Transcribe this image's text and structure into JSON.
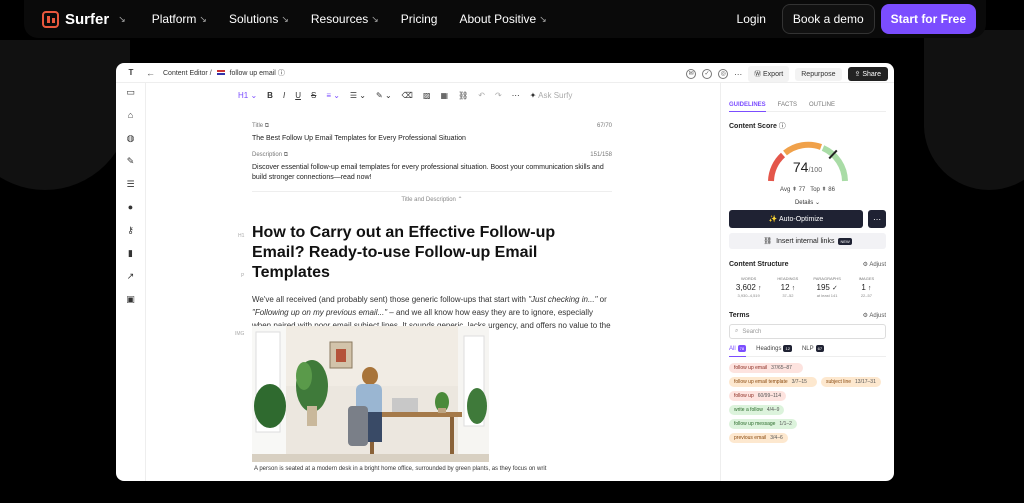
{
  "nav": {
    "brand": "Surfer",
    "items": [
      {
        "label": "Platform",
        "arrow": "↘"
      },
      {
        "label": "Solutions",
        "arrow": "↘"
      },
      {
        "label": "Resources",
        "arrow": "↘"
      },
      {
        "label": "Pricing",
        "arrow": ""
      },
      {
        "label": "About Positive",
        "arrow": "↘"
      }
    ],
    "login": "Login",
    "demo": "Book a demo",
    "cta": "Start for Free",
    "accent": "#7b4dff"
  },
  "app": {
    "sidebar_initial": "T",
    "breadcrumb_root": "Content Editor",
    "breadcrumb_sep": "/",
    "breadcrumb_doc": "follow up email",
    "export": "Export",
    "repurpose": "Repurpose",
    "share": "Share",
    "toolbar": {
      "heading": "H1",
      "ask": "Ask Surfy"
    },
    "editor": {
      "title_label": "Title",
      "title_count": "67/70",
      "title_value": "The Best Follow Up Email Templates for Every Professional Situation",
      "desc_label": "Description",
      "desc_count": "151/158",
      "desc_value": "Discover essential follow-up email templates for every professional situation. Boost your communication skills and build stronger connections—read now!",
      "title_desc_toggle": "Title and Description",
      "tag_h1": "H1",
      "tag_p": "P",
      "tag_img": "IMG",
      "heading": "How to Carry out an Effective Follow-up Email? Ready-to-use Follow-up Email Templates",
      "para_1": "We've all received (and probably sent) those generic follow-ups that start with ",
      "para_i1": "\"Just checking in...\"",
      "para_2": " or ",
      "para_i2": "\"Following up on my previous email...\"",
      "para_3": " – and we all know how easy they are to ignore, especially when paired with poor email subject lines. It sounds generic, lacks urgency, and offers no value to the recipient.",
      "caption": "A person is seated at a modern desk in a bright home office, surrounded by green plants, as they focus on writ"
    },
    "panel": {
      "tabs": [
        "GUIDELINES",
        "FACTS",
        "OUTLINE"
      ],
      "score_title": "Content Score",
      "score": "74",
      "score_max": "/100",
      "score_fraction": 0.74,
      "avg": "Avg ⇞ 77",
      "top": "Top ⇞ 86",
      "details": "Details",
      "auto_optimize": "✨ Auto-Optimize",
      "more": "⋯",
      "internal_links": "Insert internal links",
      "new_badge": "NEW",
      "structure_title": "Content Structure",
      "adjust": "Adjust",
      "stats": [
        {
          "label": "WORDS",
          "value": "3,602",
          "mark": "↑",
          "range": "3,930–4,519"
        },
        {
          "label": "HEADINGS",
          "value": "12",
          "mark": "↑",
          "range": "37–52"
        },
        {
          "label": "PARAGRAPHS",
          "value": "195",
          "mark": "✓",
          "range": "at least 141"
        },
        {
          "label": "IMAGES",
          "value": "1",
          "mark": "↑",
          "range": "22–57"
        }
      ],
      "terms_title": "Terms",
      "search_placeholder": "Search",
      "term_tabs": [
        {
          "label": "All",
          "count": "78"
        },
        {
          "label": "Headings",
          "count": "12"
        },
        {
          "label": "NLP",
          "count": "67"
        }
      ],
      "terms": [
        {
          "term": "follow up email",
          "count": "37/65–87",
          "tone": "red"
        },
        {
          "term": "follow up email template",
          "count": "3/7–15",
          "tone": "orange"
        },
        {
          "term": "subject line",
          "count": "13/17–31",
          "tone": "orange"
        },
        {
          "term": "follow up",
          "count": "60/99–114",
          "tone": "red"
        },
        {
          "term": "write a follow",
          "count": "4/4–9",
          "tone": "green"
        },
        {
          "term": "follow up message",
          "count": "1/1–2",
          "tone": "green"
        },
        {
          "term": "previous email",
          "count": "3/4–6",
          "tone": "orange"
        }
      ]
    }
  }
}
